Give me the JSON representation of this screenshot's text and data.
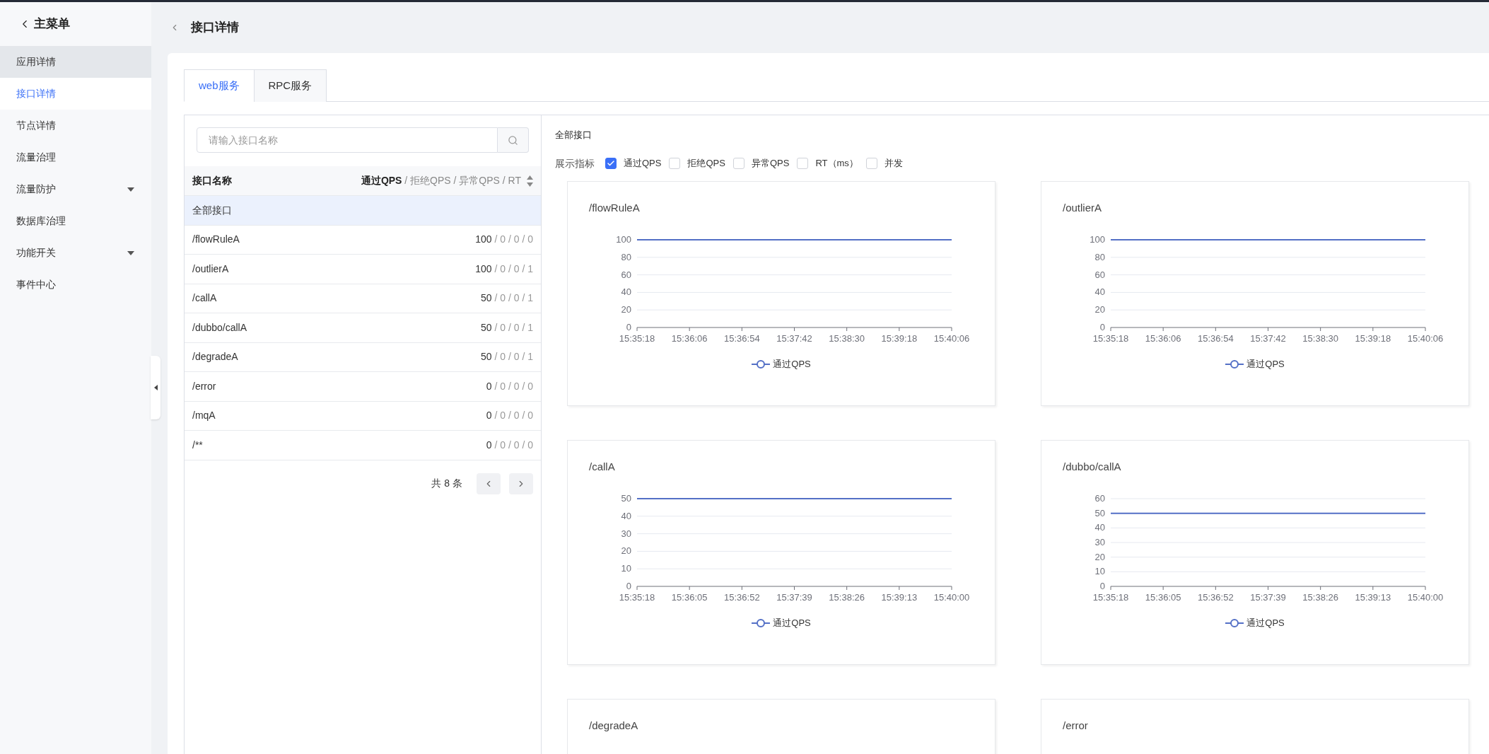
{
  "sidebar": {
    "back_label": "主菜单",
    "items": [
      {
        "label": "应用详情",
        "selected": false,
        "hovered": true,
        "has_submenu": false
      },
      {
        "label": "接口详情",
        "selected": true,
        "hovered": false,
        "has_submenu": false
      },
      {
        "label": "节点详情",
        "selected": false,
        "hovered": false,
        "has_submenu": false
      },
      {
        "label": "流量治理",
        "selected": false,
        "hovered": false,
        "has_submenu": false
      },
      {
        "label": "流量防护",
        "selected": false,
        "hovered": false,
        "has_submenu": true
      },
      {
        "label": "数据库治理",
        "selected": false,
        "hovered": false,
        "has_submenu": false
      },
      {
        "label": "功能开关",
        "selected": false,
        "hovered": false,
        "has_submenu": true
      },
      {
        "label": "事件中心",
        "selected": false,
        "hovered": false,
        "has_submenu": false
      }
    ]
  },
  "header": {
    "title": "接口详情"
  },
  "tabs": [
    {
      "label": "web服务",
      "selected": true
    },
    {
      "label": "RPC服务",
      "selected": false
    }
  ],
  "search": {
    "placeholder": "请输入接口名称"
  },
  "table": {
    "columns": [
      {
        "label": "接口名称"
      },
      {
        "label": "**通过QPS** / 拒绝QPS / 异常QPS / RT",
        "sortable": true
      }
    ],
    "rows": [
      {
        "name": "全部接口",
        "selected": true
      },
      {
        "name": "/flowRuleA",
        "value": "**100** / 0 / 0 / 0",
        "selected": false
      },
      {
        "name": "/outlierA",
        "value": "**100** / 0 / 0 / 1",
        "selected": false
      },
      {
        "name": "/callA",
        "value": "**50** / 0 / 0 / 1",
        "selected": false
      },
      {
        "name": "/dubbo/callA",
        "value": "**50** / 0 / 0 / 1",
        "selected": false
      },
      {
        "name": "/degradeA",
        "value": "**50** / 0 / 0 / 1",
        "selected": false
      },
      {
        "name": "/error",
        "value": "**0** / 0 / 0 / 0",
        "selected": false
      },
      {
        "name": "/mqA",
        "value": "**0** / 0 / 0 / 0",
        "selected": false
      },
      {
        "name": "/**",
        "value": "**0** / 0 / 0 / 0",
        "selected": false
      }
    ]
  },
  "pagination": {
    "total": "共 8 条"
  },
  "detail": {
    "title": "全部接口",
    "metrics_label": "展示指标",
    "metrics": [
      {
        "label": "通过QPS",
        "checked": true
      },
      {
        "label": "拒绝QPS",
        "checked": false
      },
      {
        "label": "异常QPS",
        "checked": false
      },
      {
        "label": "RT（ms）",
        "checked": false
      },
      {
        "label": "并发",
        "checked": false
      }
    ],
    "charts": [
      {
        "title": "/flowRuleA",
        "chart_data": {
          "type": "line",
          "x": [
            "15:35:18",
            "15:36:06",
            "15:36:54",
            "15:37:42",
            "15:38:30",
            "15:39:18",
            "15:40:06"
          ],
          "series": [
            {
              "name": "通过QPS",
              "color": "#5470c6",
              "values": [
                100,
                100,
                100,
                100,
                100,
                100,
                100
              ]
            }
          ],
          "ylim": [
            0,
            100
          ],
          "yticks": [
            0,
            20,
            40,
            60,
            80,
            100
          ],
          "grid": true
        }
      },
      {
        "title": "/outlierA",
        "chart_data": {
          "type": "line",
          "x": [
            "15:35:18",
            "15:36:06",
            "15:36:54",
            "15:37:42",
            "15:38:30",
            "15:39:18",
            "15:40:06"
          ],
          "series": [
            {
              "name": "通过QPS",
              "color": "#5470c6",
              "values": [
                100,
                100,
                100,
                100,
                100,
                100,
                100
              ]
            }
          ],
          "ylim": [
            0,
            100
          ],
          "yticks": [
            0,
            20,
            40,
            60,
            80,
            100
          ],
          "grid": true
        }
      },
      {
        "title": "/callA",
        "chart_data": {
          "type": "line",
          "x": [
            "15:35:18",
            "15:36:05",
            "15:36:52",
            "15:37:39",
            "15:38:26",
            "15:39:13",
            "15:40:00"
          ],
          "series": [
            {
              "name": "通过QPS",
              "color": "#5470c6",
              "values": [
                50,
                50,
                50,
                50,
                50,
                50,
                50
              ]
            }
          ],
          "ylim": [
            0,
            50
          ],
          "yticks": [
            0,
            10,
            20,
            30,
            40,
            50
          ],
          "grid": true
        }
      },
      {
        "title": "/dubbo/callA",
        "chart_data": {
          "type": "line",
          "x": [
            "15:35:18",
            "15:36:05",
            "15:36:52",
            "15:37:39",
            "15:38:26",
            "15:39:13",
            "15:40:00"
          ],
          "series": [
            {
              "name": "通过QPS",
              "color": "#5470c6",
              "values": [
                50,
                50,
                50,
                50,
                50,
                50,
                50
              ]
            }
          ],
          "ylim": [
            0,
            60
          ],
          "yticks": [
            0,
            10,
            20,
            30,
            40,
            50,
            60
          ],
          "grid": true
        }
      },
      {
        "title": "/degradeA"
      },
      {
        "title": "/error"
      }
    ]
  }
}
